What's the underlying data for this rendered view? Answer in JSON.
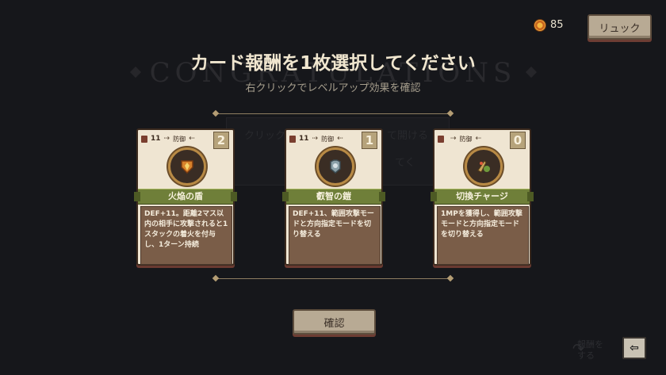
{
  "header": {
    "coin_count": "85",
    "bag_label": "リュック"
  },
  "background": {
    "congrats_text": "CONGRATULATIONS",
    "panel_hint": "クリック",
    "panel_hint2": "て開ける",
    "panel_hint3": "てく",
    "skip_line1": "報酬を",
    "skip_line2": "する"
  },
  "title": "カード報酬を1枚選択してください",
  "subtitle": "右クリックでレベルアップ効果を確認",
  "cards": [
    {
      "tag_value": "11",
      "type": "防御",
      "cost": "2",
      "name": "火焔の盾",
      "desc": "DEF+11。距離2マス以内の相手に攻撃されると1スタックの着火を付与し、1ターン持続",
      "emblem": "flame-shield-icon",
      "emblem_color": "#d9822b"
    },
    {
      "tag_value": "11",
      "type": "防御",
      "cost": "1",
      "name": "叡智の鎧",
      "desc": "DEF+11、範囲攻撃モードと方向指定モードを切り替える",
      "emblem": "wisdom-armor-icon",
      "emblem_color": "#8aa0a8"
    },
    {
      "tag_value": "",
      "type": "防御",
      "cost": "0",
      "name": "切換チャージ",
      "desc": "1MPを獲得し、範囲攻撃モードと方向指定モードを切り替える",
      "emblem": "switch-charge-icon",
      "emblem_color": "#c9a55a"
    }
  ],
  "confirm_label": "確認",
  "back_icon": "back-arrow-icon"
}
